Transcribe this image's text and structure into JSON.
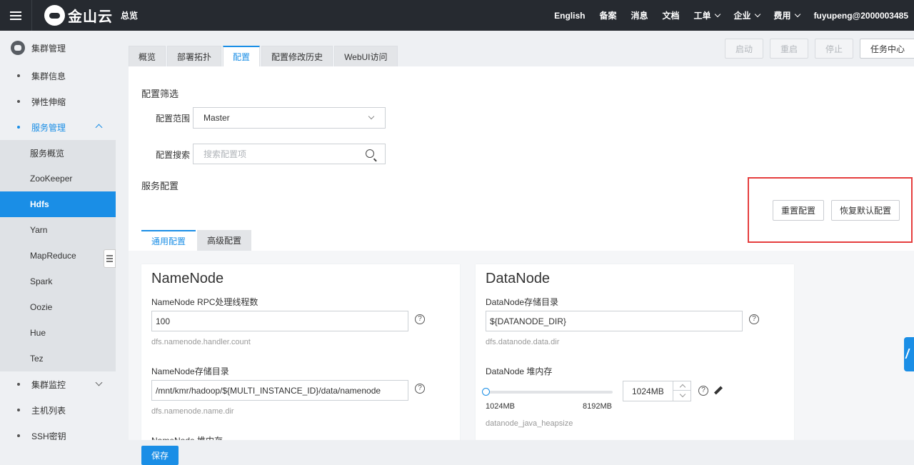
{
  "topbar": {
    "logo_text": "金山云",
    "overview": "总览",
    "nav": [
      {
        "label": "English",
        "dropdown": false
      },
      {
        "label": "备案",
        "dropdown": false
      },
      {
        "label": "消息",
        "dropdown": false
      },
      {
        "label": "文档",
        "dropdown": false
      },
      {
        "label": "工单",
        "dropdown": true
      },
      {
        "label": "企业",
        "dropdown": true
      },
      {
        "label": "费用",
        "dropdown": true
      },
      {
        "label": "fuyupeng@2000003485",
        "dropdown": false
      }
    ]
  },
  "sidebar": {
    "header": "集群管理",
    "items": [
      "集群信息",
      "弹性伸缩",
      "服务管理",
      "集群监控",
      "主机列表",
      "SSH密钥"
    ],
    "services": [
      "服务概览",
      "ZooKeeper",
      "Hdfs",
      "Yarn",
      "MapReduce",
      "Spark",
      "Oozie",
      "Hue",
      "Tez"
    ],
    "selected_service": "Hdfs"
  },
  "tabs": [
    "概览",
    "部署拓扑",
    "配置",
    "配置修改历史",
    "WebUI访问"
  ],
  "active_tab": "配置",
  "actions": {
    "start": "启动",
    "restart": "重启",
    "stop": "停止",
    "task_center": "任务中心"
  },
  "filter": {
    "title": "配置筛选",
    "scope_label": "配置范围",
    "scope_value": "Master",
    "search_label": "配置搜索",
    "search_placeholder": "搜索配置项"
  },
  "service_config": {
    "title": "服务配置",
    "reset_button": "重置配置",
    "restore_default_button": "恢复默认配置",
    "subtabs": [
      "通用配置",
      "高级配置"
    ]
  },
  "namenode": {
    "title": "NameNode",
    "rpc_label": "NameNode RPC处理线程数",
    "rpc_value": "100",
    "rpc_key": "dfs.namenode.handler.count",
    "dir_label": "NameNode存储目录",
    "dir_value": "/mnt/kmr/hadoop/${MULTI_INSTANCE_ID}/data/namenode",
    "dir_key": "dfs.namenode.name.dir",
    "heap_label_partial": "NameNode 堆内存"
  },
  "datanode": {
    "title": "DataNode",
    "dir_label": "DataNode存储目录",
    "dir_value": "${DATANODE_DIR}",
    "dir_key": "dfs.datanode.data.dir",
    "heap_label": "DataNode 堆内存",
    "heap_value": "1024MB",
    "heap_min": "1024MB",
    "heap_max": "8192MB",
    "heap_fraction": 0.0,
    "heap_key": "datanode_java_heapsize"
  },
  "save_button": "保存",
  "colors": {
    "primary": "#1a8ee6",
    "topbar": "#262a30",
    "highlight": "#e53e3e"
  }
}
